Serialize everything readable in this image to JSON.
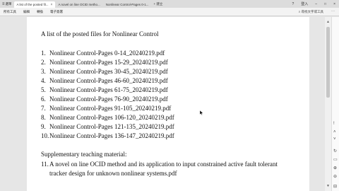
{
  "titlebar": {
    "menu_label": "選單",
    "tabs": [
      {
        "label": "A list of the posted fil..."
      },
      {
        "label": "A novel on line OCID metho..."
      },
      {
        "label": "Nonlinear Control-Pages 0-1..."
      }
    ],
    "new_tab_label": "+ 建立",
    "sign_in_label": "登入"
  },
  "toolbar": {
    "items": [
      "所有工具",
      "編輯",
      "轉換",
      "電子簽署"
    ],
    "search_label": "尋找文字或工具"
  },
  "document": {
    "heading": "A list of the posted files for Nonlinear Control",
    "files": [
      {
        "num": "1.",
        "name": "Nonlinear Control-Pages 0-14_20240219.pdf"
      },
      {
        "num": "2.",
        "name": "Nonlinear Control-Pages 15-29_20240219.pdf"
      },
      {
        "num": "3.",
        "name": "Nonlinear Control-Pages 30-45_20240219.pdf"
      },
      {
        "num": "4.",
        "name": "Nonlinear Control-Pages 46-60_20240219.pdf"
      },
      {
        "num": "5.",
        "name": "Nonlinear Control-Pages 61-75_20240219.pdf"
      },
      {
        "num": "6.",
        "name": "Nonlinear Control-Pages 76-90_20240219.pdf"
      },
      {
        "num": "7.",
        "name": "Nonlinear Control-Pages 91-105_20240219.pdf"
      },
      {
        "num": "8.",
        "name": "Nonlinear Control-Pages 106-120_20240219.pdf"
      },
      {
        "num": "9.",
        "name": "Nonlinear Control-Pages 121-135_20240219.pdf"
      },
      {
        "num": "10.",
        "name": "Nonlinear Control-Pages 136-147_20240219.pdf"
      }
    ],
    "supplementary_title": "Supplementary teaching material:",
    "supplementary_items": [
      {
        "num": "11.",
        "text": "A novel on line OCID method and its application to input constrained active fault tolerant tracker design for unknown nonlinear systems.pdf"
      }
    ]
  },
  "icons": {
    "menu": "menu-icon",
    "close": "close-icon",
    "search": "search-icon",
    "more": "more-icon",
    "minimize": "minimize-icon",
    "maximize": "maximize-icon",
    "window_close": "window-close-icon"
  },
  "colors": {
    "titlebar_bg": "#dcdcdc",
    "toolbar_bg": "#f3f3f3",
    "viewer_bg": "#e6e6e6",
    "page_bg": "#ffffff",
    "text": "#111111"
  }
}
